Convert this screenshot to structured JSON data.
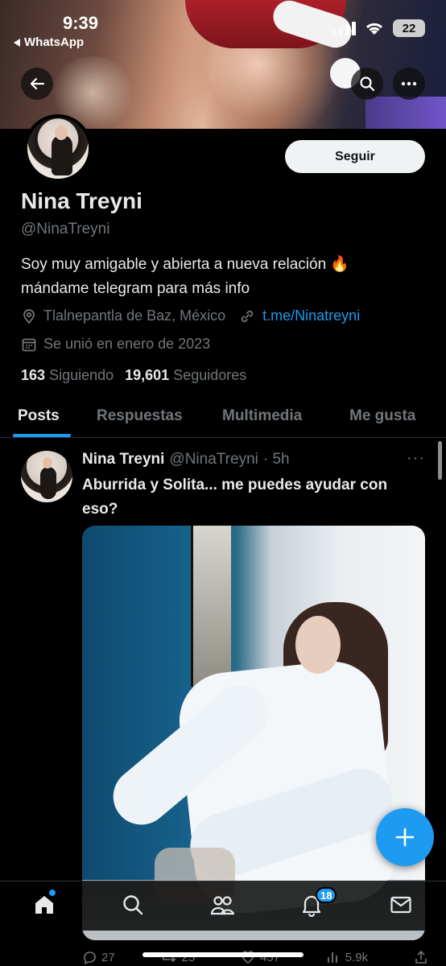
{
  "status_bar": {
    "time": "9:39",
    "back_app": "WhatsApp",
    "battery": "22"
  },
  "header": {
    "back_icon": "arrow-left-icon",
    "search_icon": "search-icon",
    "more_icon": "more-horizontal-icon"
  },
  "profile": {
    "name": "Nina Treyni",
    "handle": "@NinaTreyni",
    "follow_label": "Seguir",
    "bio_line1": "Soy muy amigable y abierta a nueva relación 🔥",
    "bio_line2": "mándame telegram para más info",
    "location": "Tlalnepantla de Baz, México",
    "link": "t.me/Ninatreyni",
    "joined": "Se unió en enero de 2023",
    "following_count": "163",
    "following_label": "Siguiendo",
    "followers_count": "19,601",
    "followers_label": "Seguidores"
  },
  "tabs": [
    {
      "label": "Posts",
      "active": true
    },
    {
      "label": "Respuestas",
      "active": false
    },
    {
      "label": "Multimedia",
      "active": false
    },
    {
      "label": "Me gusta",
      "active": false
    }
  ],
  "post": {
    "author": "Nina Treyni",
    "handle": "@NinaTreyni",
    "time": "· 5h",
    "text": "Aburrida y Solita... me puedes ayudar con eso?",
    "more": "···",
    "replies": "27",
    "reposts": "25",
    "likes": "457",
    "views": "5.9k"
  },
  "bottom_nav": {
    "home_icon": "home-icon",
    "search_icon": "search-icon",
    "communities_icon": "people-icon",
    "notifications_icon": "bell-icon",
    "notifications_count": "18",
    "messages_icon": "mail-icon"
  },
  "fab_icon": "plus-icon",
  "colors": {
    "accent": "#1d9bf0",
    "background": "#000000",
    "muted": "#71767b",
    "text": "#e7e9ea"
  }
}
